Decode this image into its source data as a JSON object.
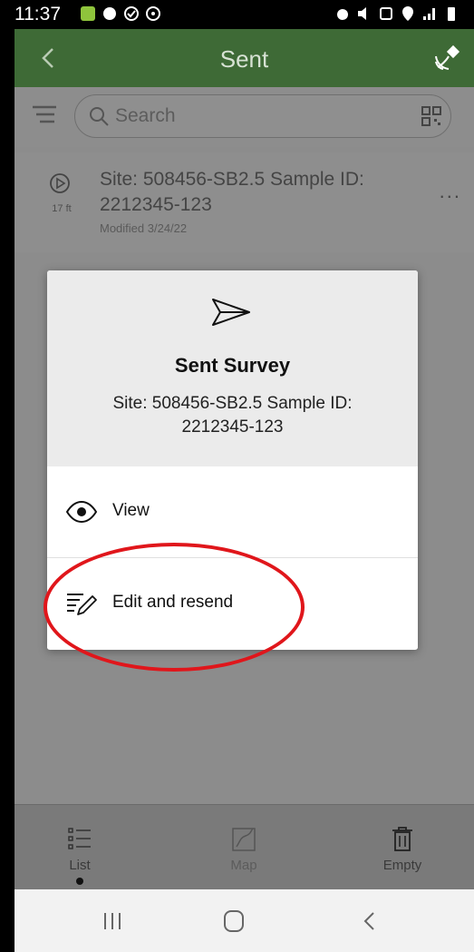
{
  "status_bar": {
    "time": "11:37"
  },
  "header": {
    "title": "Sent"
  },
  "search": {
    "placeholder": "Search"
  },
  "list": {
    "items": [
      {
        "title": "Site: 508456-SB2.5 Sample ID: 2212345-123",
        "distance": "17 ft",
        "modified": "Modified 3/24/22",
        "more": "..."
      }
    ]
  },
  "dialog": {
    "icon": "send-icon",
    "title": "Sent Survey",
    "subtitle": "Site: 508456-SB2.5 Sample ID: 2212345-123",
    "actions": [
      {
        "label": "View",
        "icon": "eye-icon"
      },
      {
        "label": "Edit and resend",
        "icon": "edit-lines-icon"
      }
    ]
  },
  "tabs": [
    {
      "label": "List",
      "icon": "list-icon",
      "selected": true
    },
    {
      "label": "Map",
      "icon": "map-icon",
      "selected": false
    },
    {
      "label": "Empty",
      "icon": "trash-icon",
      "selected": false
    }
  ],
  "annotation": {
    "color": "#e0161b"
  },
  "colors": {
    "header_bg": "#3e6a36",
    "dim_bg": "#8c8c8c"
  }
}
